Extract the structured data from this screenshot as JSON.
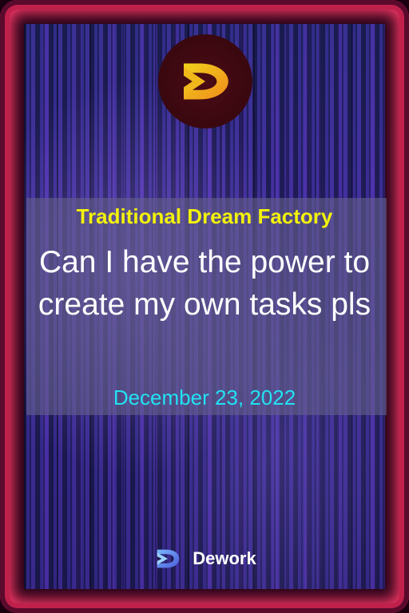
{
  "card": {
    "organization": "Traditional Dream Factory",
    "message": "Can I have the power to create my own tasks pls",
    "date": "December 23, 2022"
  },
  "footer": {
    "brand": "Dework",
    "icon": "dework-logo-icon"
  },
  "logo": {
    "icon": "dream-factory-logo-icon"
  },
  "colors": {
    "frame_glow": "#ff3a6a",
    "org_text": "#f2f20a",
    "date_text": "#21e3f2",
    "logo_orange": "#f08a1c",
    "logo_yellow": "#f1d21b"
  }
}
